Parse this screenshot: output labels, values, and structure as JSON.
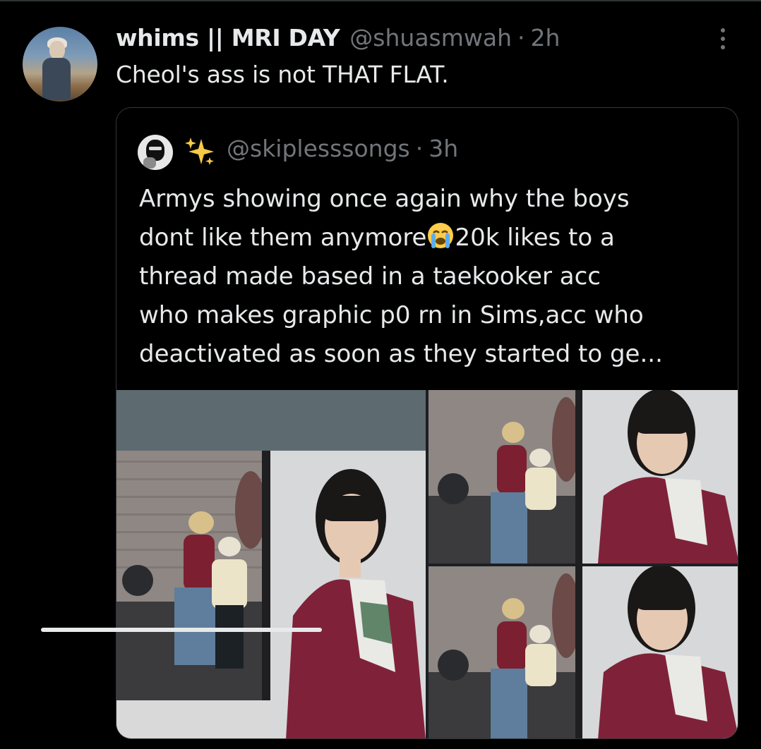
{
  "tweet": {
    "display_name": "whims || MRI DAY",
    "handle": "@shuasmwah",
    "separator": "·",
    "time": "2h",
    "text": "Cheol's ass is not THAT FLAT."
  },
  "quoted_tweet": {
    "emoji": "✨",
    "handle": "@skiplesssongs",
    "separator": "·",
    "time": "3h",
    "text_lines": [
      "Armys showing once again why the boys",
      "dont like them anymore",
      "20k likes to a",
      "thread made based in a taekooker acc",
      "who makes graphic p0 rn in Sims,acc who",
      "deactivated as soon as they started to ge..."
    ],
    "media_count": 3
  },
  "icons": {
    "more": "more-vertical-icon",
    "sparkle": "sparkles-icon",
    "crying": "loudly-crying-face-emoji"
  },
  "colors": {
    "background": "#000000",
    "text_primary": "#e7e9ea",
    "text_secondary": "#71767b",
    "border": "#333639"
  }
}
